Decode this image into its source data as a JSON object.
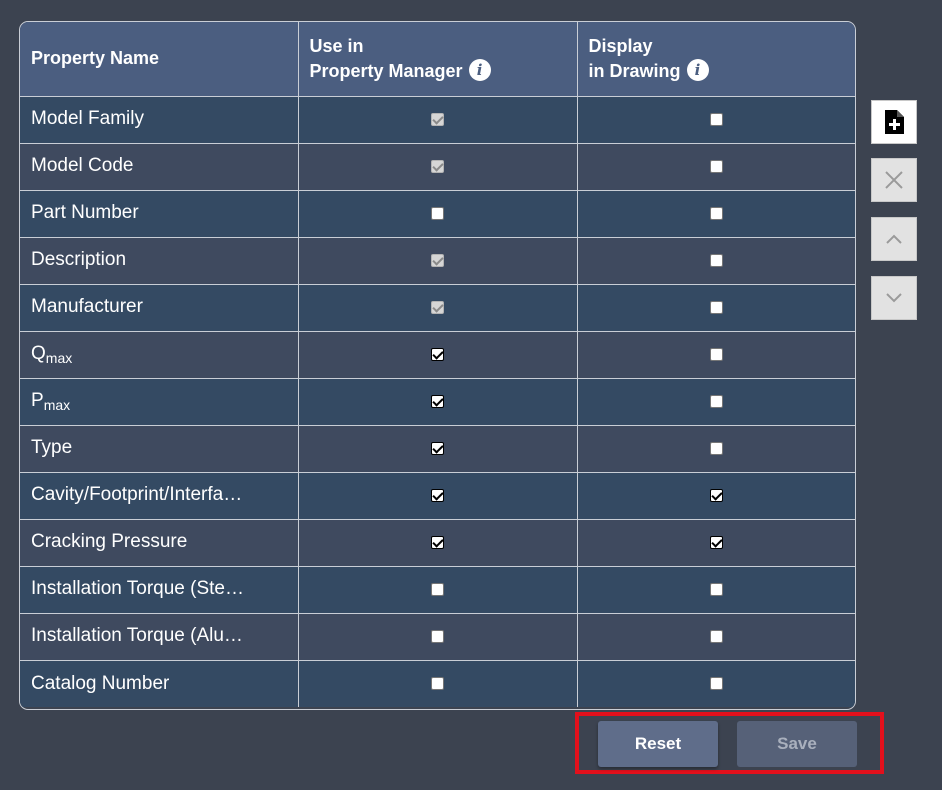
{
  "table": {
    "headers": {
      "col1": "Property Name",
      "col2_line1": "Use in",
      "col2_line2": "Property Manager",
      "col3_line1": "Display",
      "col3_line2": "in Drawing"
    },
    "rows": [
      {
        "name": "Model Family",
        "sub": "",
        "use": "checked-disabled",
        "display": "unchecked"
      },
      {
        "name": "Model Code",
        "sub": "",
        "use": "checked-disabled",
        "display": "unchecked"
      },
      {
        "name": "Part Number",
        "sub": "",
        "use": "unchecked",
        "display": "unchecked"
      },
      {
        "name": "Description",
        "sub": "",
        "use": "checked-disabled",
        "display": "unchecked"
      },
      {
        "name": "Manufacturer",
        "sub": "",
        "use": "checked-disabled",
        "display": "unchecked"
      },
      {
        "name": "Q",
        "sub": "max",
        "use": "checked",
        "display": "unchecked"
      },
      {
        "name": "P",
        "sub": "max",
        "use": "checked",
        "display": "unchecked"
      },
      {
        "name": "Type",
        "sub": "",
        "use": "checked",
        "display": "unchecked"
      },
      {
        "name": "Cavity/Footprint/Interfa…",
        "sub": "",
        "use": "checked",
        "display": "checked"
      },
      {
        "name": "Cracking Pressure",
        "sub": "",
        "use": "checked",
        "display": "checked"
      },
      {
        "name": "Installation Torque (Ste…",
        "sub": "",
        "use": "unchecked",
        "display": "unchecked"
      },
      {
        "name": "Installation Torque (Alu…",
        "sub": "",
        "use": "unchecked",
        "display": "unchecked"
      },
      {
        "name": "Catalog Number",
        "sub": "",
        "use": "unchecked",
        "display": "unchecked"
      }
    ]
  },
  "side_toolbar": {
    "add_icon": "add-file-icon",
    "delete_icon": "close-icon",
    "up_icon": "chevron-up-icon",
    "down_icon": "chevron-down-icon"
  },
  "footer": {
    "reset_label": "Reset",
    "save_label": "Save"
  },
  "colors": {
    "background": "#3c4350",
    "header": "#4b5e80",
    "row_odd": "#344a63",
    "row_even": "#3f4a5f",
    "highlight": "#e2101c"
  }
}
